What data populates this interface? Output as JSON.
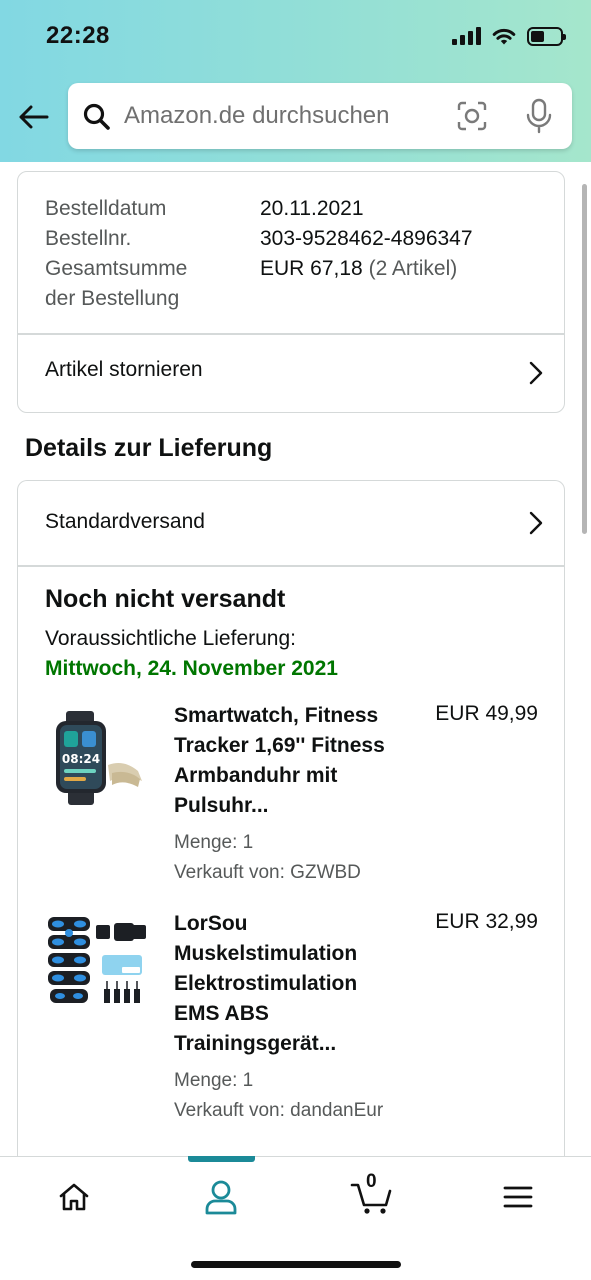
{
  "status_bar": {
    "time": "22:28"
  },
  "search": {
    "placeholder": "Amazon.de durchsuchen"
  },
  "order_summary": {
    "rows": [
      {
        "label": "Bestelldatum",
        "value": "20.11.2021"
      },
      {
        "label": "Bestellnr.",
        "value": "303-9528462-4896347"
      },
      {
        "label": "Gesamtsumme",
        "value": "EUR 67,18",
        "value_extra": "(2 Artikel)"
      }
    ],
    "label_continued": "der Bestellung",
    "cancel_link": "Artikel stornieren"
  },
  "delivery": {
    "section_title": "Details zur Lieferung",
    "shipping_method": "Standardversand",
    "status": "Noch nicht versandt",
    "eta_label": "Voraussichtliche Lieferung:",
    "eta_date": "Mittwoch, 24. November 2021",
    "eta_color": "#007600",
    "items": [
      {
        "title_lines": [
          "Smartwatch, Fitness",
          "Tracker 1,69'' Fitness",
          "Armbanduhr mit",
          "Pulsuhr..."
        ],
        "price": "EUR 49,99",
        "quantity": "Menge: 1",
        "seller": "Verkauft von: GZWBD",
        "image": "smartwatch-image",
        "watch_time": "08:24"
      },
      {
        "title_lines": [
          "LorSou",
          "Muskelstimulation",
          "Elektrostimulation",
          "EMS ABS",
          "Trainingsgerät..."
        ],
        "price": "EUR 32,99",
        "quantity": "Menge: 1",
        "seller": "Verkauft von: dandanEur",
        "image": "ems-trainer-image"
      }
    ]
  },
  "bottom_nav": {
    "items": [
      "home-icon",
      "account-icon",
      "cart-icon",
      "menu-icon"
    ],
    "cart_count": "0",
    "active": "account",
    "accent_color": "#1b8a98"
  }
}
